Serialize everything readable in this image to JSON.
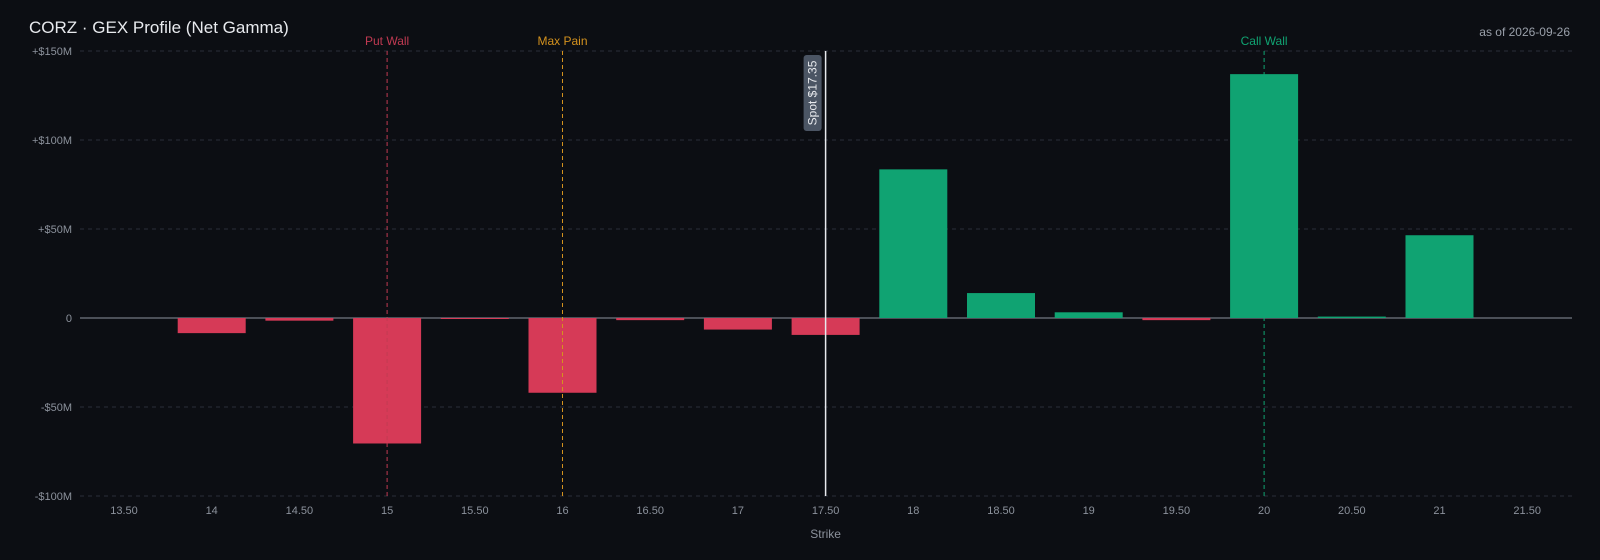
{
  "header": {
    "title": "CORZ · GEX Profile (Net Gamma)",
    "as_of": "as of 2026-09-26"
  },
  "colors": {
    "positive": "#10a372",
    "negative": "#d63a57",
    "put_wall": "#c13a52",
    "max_pain": "#d4921e",
    "call_wall": "#10a372",
    "spot": "#e8eaee",
    "grid": "#2a2f38",
    "zero_line": "#8c929c",
    "spot_badge": "#4b5564"
  },
  "chart_data": {
    "type": "bar",
    "title": "CORZ · GEX Profile (Net Gamma)",
    "xlabel": "Strike",
    "ylabel": "",
    "categories": [
      "13.50",
      "14",
      "14.50",
      "15",
      "15.50",
      "16",
      "16.50",
      "17",
      "17.50",
      "18",
      "18.50",
      "19",
      "19.50",
      "20",
      "20.50",
      "21",
      "21.50"
    ],
    "values": [
      0,
      -8.5,
      -1.5,
      -70.5,
      -0.5,
      -42,
      -1.2,
      -6.5,
      -9.5,
      83.5,
      14,
      3.2,
      -1.2,
      137,
      0.8,
      46.5,
      0
    ],
    "value_unit": "$M",
    "ylim": [
      -100,
      150
    ],
    "yticks": [
      150,
      100,
      50,
      0,
      -50,
      -100
    ],
    "ytick_labels": [
      "+$150M",
      "+$100M",
      "+$50M",
      "0",
      "-$50M",
      "-$100M"
    ],
    "grid": true,
    "reference_lines": [
      {
        "key": "put_wall",
        "label": "Put Wall",
        "strike": "15"
      },
      {
        "key": "max_pain",
        "label": "Max Pain",
        "strike": "16"
      },
      {
        "key": "call_wall",
        "label": "Call Wall",
        "strike": "20"
      }
    ],
    "spot": {
      "label": "Spot $17.35",
      "strike": "17.50"
    }
  }
}
